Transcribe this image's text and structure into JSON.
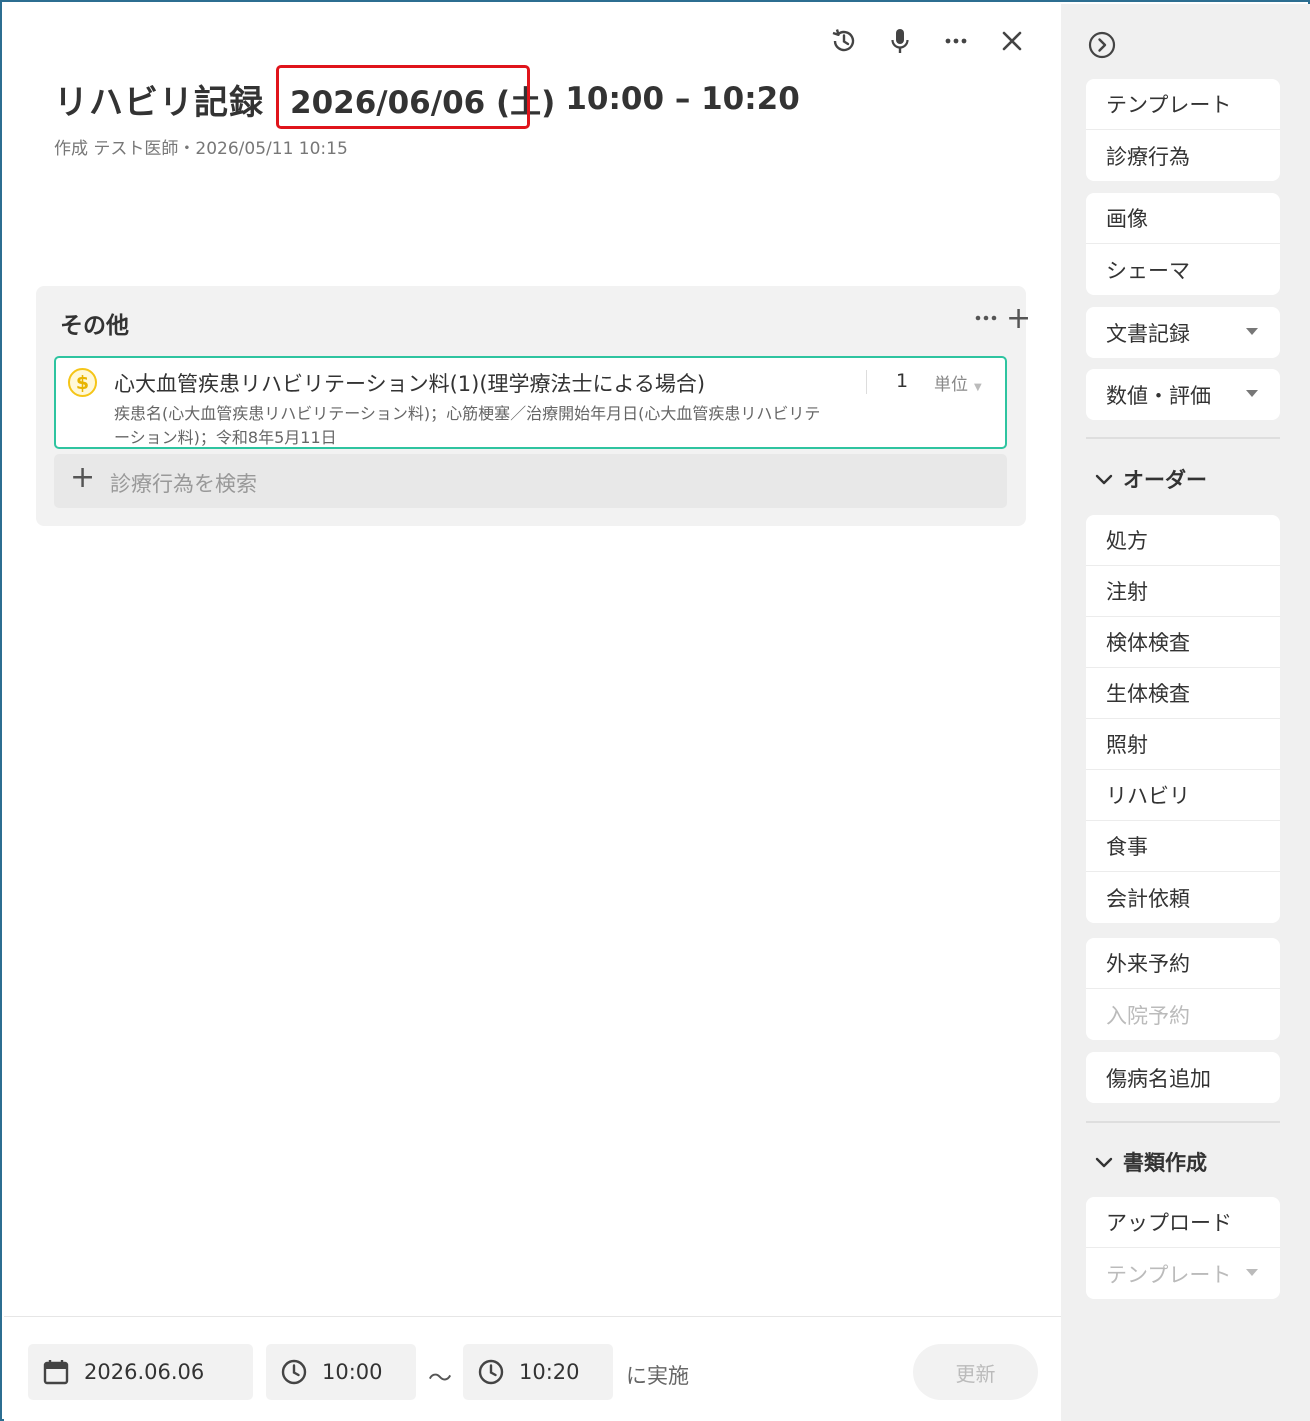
{
  "header": {
    "title": "リハビリ記録",
    "date": "2026/06/06 (土)",
    "time_range": "10:00 – 10:20",
    "meta": "作成 テスト医師・2026/05/11 10:15",
    "icons": [
      "history-icon",
      "microphone-icon",
      "more-icon",
      "close-icon"
    ]
  },
  "section": {
    "title": "その他",
    "item": {
      "name": "心大血管疾患リハビリテーション料(1)(理学療法士による場合)",
      "detail": "疾患名(心大血管疾患リハビリテーション料)；心筋梗塞／治療開始年月日(心大血管疾患リハビリテーション料)；令和8年5月11日",
      "quantity": "1",
      "unit": "単位",
      "coin_symbol": "$"
    },
    "search_placeholder": "診療行為を検索"
  },
  "footer": {
    "date": "2026.06.06",
    "start_time": "10:00",
    "tilde": "〜",
    "end_time": "10:20",
    "suffix": "に実施",
    "update_label": "更新"
  },
  "sidebar": {
    "group1": [
      "テンプレート",
      "診療行為"
    ],
    "group2": [
      "画像",
      "シェーマ"
    ],
    "group3": "文書記録",
    "group4": "数値・評価",
    "orders_heading": "オーダー",
    "orders": [
      "処方",
      "注射",
      "検体検査",
      "生体検査",
      "照射",
      "リハビリ",
      "食事",
      "会計依頼"
    ],
    "reservations": [
      "外来予約",
      "入院予約"
    ],
    "disease_add": "傷病名追加",
    "docs_heading": "書類作成",
    "docs": [
      "アップロード",
      "テンプレート"
    ]
  },
  "colors": {
    "frame": "#2c6e91",
    "highlight": "#e0141b",
    "item_border": "#2ec4a0",
    "coin": "#f5c518"
  }
}
